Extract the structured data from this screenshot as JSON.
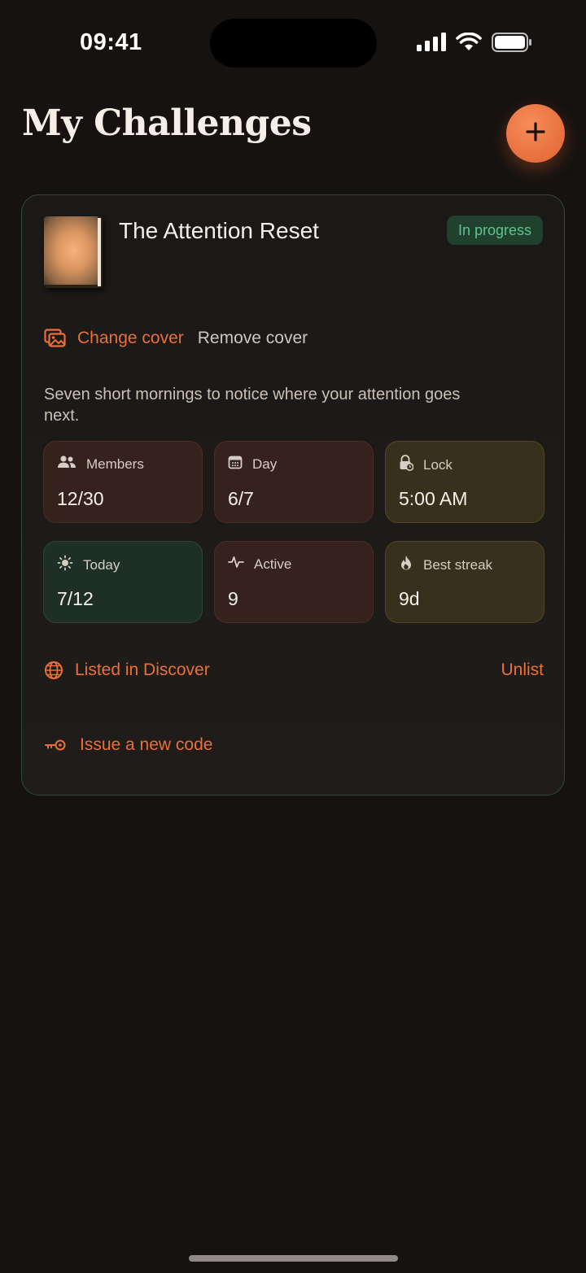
{
  "status_bar": {
    "time": "09:41"
  },
  "header": {
    "title": "My Challenges",
    "add_icon": "plus-icon"
  },
  "challenge": {
    "title": "The Attention Reset",
    "status": "In progress",
    "cover_actions": {
      "change": "Change cover",
      "remove": "Remove cover"
    },
    "description": "Seven short mornings to notice where your attention goes next.",
    "stats": [
      {
        "icon": "people-icon",
        "label": "Members",
        "value": "12/30",
        "tone": "red"
      },
      {
        "icon": "calendar-icon",
        "label": "Day",
        "value": "6/7",
        "tone": "red"
      },
      {
        "icon": "lock-clock-icon",
        "label": "Lock",
        "value": "5:00 AM",
        "tone": "amber"
      },
      {
        "icon": "sun-icon",
        "label": "Today",
        "value": "7/12",
        "tone": "green"
      },
      {
        "icon": "pulse-icon",
        "label": "Active",
        "value": "9",
        "tone": "red"
      },
      {
        "icon": "flame-icon",
        "label": "Best streak",
        "value": "9d",
        "tone": "amber"
      }
    ],
    "discover": {
      "label": "Listed in Discover",
      "action": "Unlist"
    },
    "code": {
      "label": "Issue a new code"
    }
  },
  "colors": {
    "accent": "#ea6f3b",
    "success": "#5ec48b",
    "background": "#151210"
  }
}
